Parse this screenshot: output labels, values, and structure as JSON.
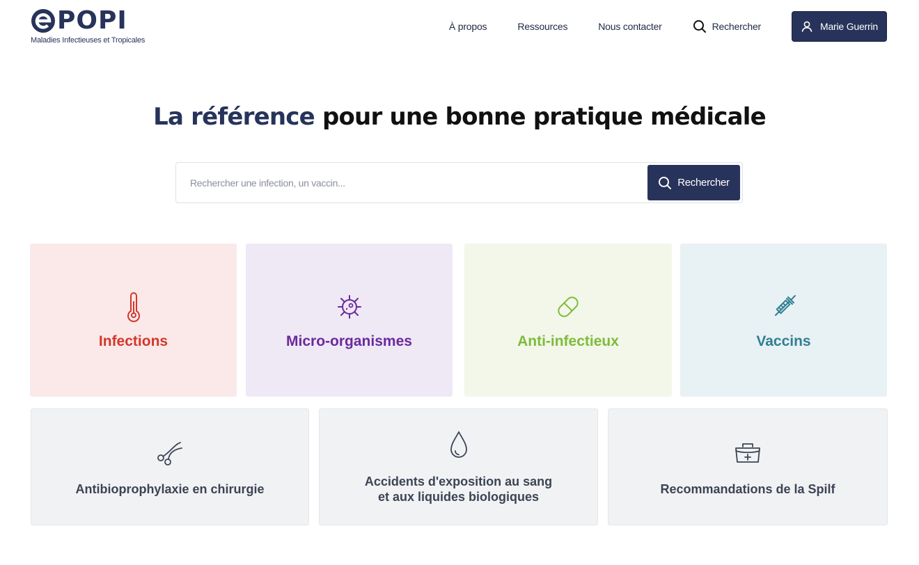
{
  "brand": {
    "logo_text": "POPI",
    "logo_subtitle": "Maladies Infectieuses et Tropicales",
    "primary_color": "#27335a"
  },
  "nav": {
    "links": [
      "À propos",
      "Ressources",
      "Nous contacter"
    ],
    "search_label": "Rechercher",
    "user_name": "Marie Guerrin"
  },
  "hero": {
    "title_accent": "La référence",
    "title_rest": " pour une bonne pratique médicale"
  },
  "search": {
    "placeholder": "Rechercher une infection, un vaccin...",
    "button_label": "Rechercher"
  },
  "categories": [
    {
      "label": "Infections",
      "icon": "thermometer-icon",
      "color": "#d4362c"
    },
    {
      "label": "Micro-organismes",
      "icon": "virus-icon",
      "color": "#6a2a9c"
    },
    {
      "label": "Anti-infectieux",
      "icon": "pill-icon",
      "color": "#7fbb3a"
    },
    {
      "label": "Vaccins",
      "icon": "syringe-icon",
      "color": "#2f7f93"
    }
  ],
  "resources": [
    {
      "label": "Antibioprophylaxie en chirurgie",
      "icon": "surgical-scissors-icon"
    },
    {
      "label_line1": "Accidents d'exposition au sang",
      "label_line2": "et aux liquides biologiques",
      "icon": "blood-drop-icon"
    },
    {
      "label": "Recommandations de la Spilf",
      "icon": "medical-kit-icon"
    }
  ]
}
